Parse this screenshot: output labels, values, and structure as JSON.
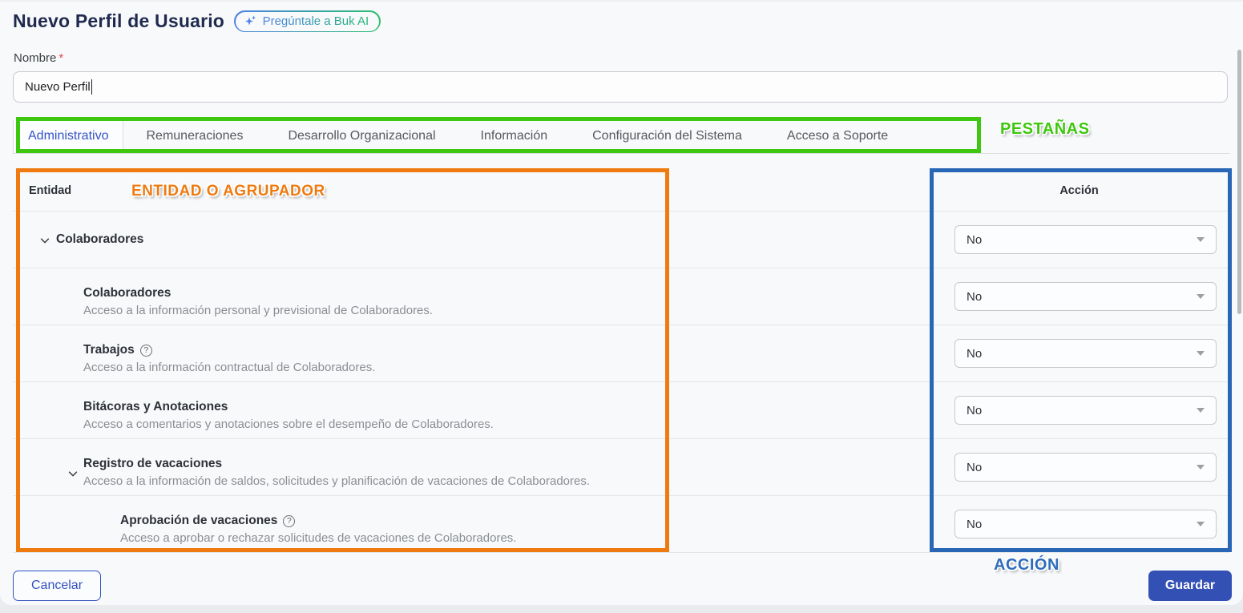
{
  "page": {
    "title": "Nuevo Perfil de Usuario",
    "ai_button_label": "Pregúntale a Buk AI"
  },
  "form": {
    "name_label": "Nombre",
    "required_asterisk": "*",
    "name_value": "Nuevo Perfil"
  },
  "tabs": {
    "items": [
      {
        "label": "Administrativo",
        "active": true
      },
      {
        "label": "Remuneraciones",
        "active": false
      },
      {
        "label": "Desarrollo Organizacional",
        "active": false
      },
      {
        "label": "Información",
        "active": false
      },
      {
        "label": "Configuración del Sistema",
        "active": false
      },
      {
        "label": "Acceso a Soporte",
        "active": false
      }
    ]
  },
  "table": {
    "entity_header": "Entidad",
    "action_header": "Acción",
    "rows": [
      {
        "title": "Colaboradores",
        "level": 0,
        "expandable": true,
        "description": "",
        "action": "No"
      },
      {
        "title": "Colaboradores",
        "level": 1,
        "expandable": false,
        "description": "Acceso a la información personal y previsional de Colaboradores.",
        "action": "No"
      },
      {
        "title": "Trabajos",
        "level": 1,
        "expandable": false,
        "has_help_icon": true,
        "help_glyph": "?",
        "description": "Acceso a la información contractual de Colaboradores.",
        "action": "No"
      },
      {
        "title": "Bitácoras y Anotaciones",
        "level": 1,
        "expandable": false,
        "description": "Acceso a comentarios y anotaciones sobre el desempeño de Colaboradores.",
        "action": "No"
      },
      {
        "title": "Registro de vacaciones",
        "level": 1,
        "expandable": true,
        "description": "Acceso a la información de saldos, solicitudes y planificación de vacaciones de Colaboradores.",
        "action": "No"
      },
      {
        "title": "Aprobación de vacaciones",
        "level": 2,
        "expandable": false,
        "has_help_icon": true,
        "help_glyph": "?",
        "description": "Acceso a aprobar o rechazar solicitudes de vacaciones de Colaboradores.",
        "action": "No"
      }
    ]
  },
  "annotations": {
    "tabs_label": "PESTAÑAS",
    "entity_label": "ENTIDAD O AGRUPADOR",
    "action_label": "ACCIÓN",
    "green_color": "#3ec70f",
    "orange_color": "#ee7a10",
    "blue_color": "#2767b5"
  },
  "footer": {
    "cancel_label": "Cancelar",
    "save_label": "Guardar"
  },
  "colors": {
    "title_navy": "#1f2a4e",
    "active_tab_blue": "#3353c5",
    "save_button_blue": "#3350b5",
    "ai_gradient_start": "#4d82e8",
    "ai_gradient_end": "#2fbf71",
    "required_red": "#e5484d"
  }
}
